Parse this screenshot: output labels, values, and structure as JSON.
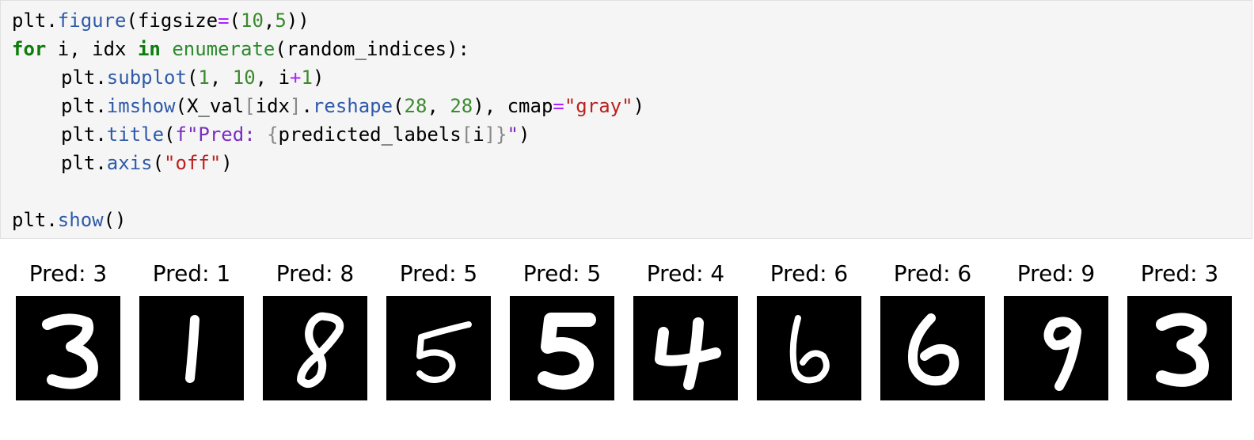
{
  "code_cell": {
    "lines": [
      {
        "indent": false,
        "tokens": [
          {
            "t": "plt.",
            "c": "#000000"
          },
          {
            "t": "figure",
            "c": "#2f5aa8"
          },
          {
            "t": "(figsize",
            "c": "#000000"
          },
          {
            "t": "=",
            "c": "#aa22ff"
          },
          {
            "t": "(",
            "c": "#000000"
          },
          {
            "t": "10",
            "c": "#3c8a2e"
          },
          {
            "t": ",",
            "c": "#000000"
          },
          {
            "t": "5",
            "c": "#3c8a2e"
          },
          {
            "t": "))",
            "c": "#000000"
          }
        ]
      },
      {
        "indent": false,
        "tokens": [
          {
            "t": "for",
            "c": "#0a7d0a",
            "kw": true
          },
          {
            "t": " i, idx ",
            "c": "#000000"
          },
          {
            "t": "in",
            "c": "#0a7d0a",
            "kw": true
          },
          {
            "t": " ",
            "c": "#000000"
          },
          {
            "t": "enumerate",
            "c": "#2e8b2e"
          },
          {
            "t": "(random_indices):",
            "c": "#000000"
          }
        ]
      },
      {
        "indent": true,
        "tokens": [
          {
            "t": "plt.",
            "c": "#000000"
          },
          {
            "t": "subplot",
            "c": "#2f5aa8"
          },
          {
            "t": "(",
            "c": "#000000"
          },
          {
            "t": "1",
            "c": "#3c8a2e"
          },
          {
            "t": ", ",
            "c": "#000000"
          },
          {
            "t": "10",
            "c": "#3c8a2e"
          },
          {
            "t": ", i",
            "c": "#000000"
          },
          {
            "t": "+",
            "c": "#aa22ff"
          },
          {
            "t": "1",
            "c": "#3c8a2e"
          },
          {
            "t": ")",
            "c": "#000000"
          }
        ]
      },
      {
        "indent": true,
        "tokens": [
          {
            "t": "plt.",
            "c": "#000000"
          },
          {
            "t": "imshow",
            "c": "#2f5aa8"
          },
          {
            "t": "(X_val",
            "c": "#000000"
          },
          {
            "t": "[",
            "c": "#888888"
          },
          {
            "t": "idx",
            "c": "#000000"
          },
          {
            "t": "]",
            "c": "#888888"
          },
          {
            "t": ".",
            "c": "#000000"
          },
          {
            "t": "reshape",
            "c": "#2f5aa8"
          },
          {
            "t": "(",
            "c": "#000000"
          },
          {
            "t": "28",
            "c": "#3c8a2e"
          },
          {
            "t": ", ",
            "c": "#000000"
          },
          {
            "t": "28",
            "c": "#3c8a2e"
          },
          {
            "t": "), cmap",
            "c": "#000000"
          },
          {
            "t": "=",
            "c": "#aa22ff"
          },
          {
            "t": "\"gray\"",
            "c": "#ba2121"
          },
          {
            "t": ")",
            "c": "#000000"
          }
        ]
      },
      {
        "indent": true,
        "tokens": [
          {
            "t": "plt.",
            "c": "#000000"
          },
          {
            "t": "title",
            "c": "#2f5aa8"
          },
          {
            "t": "(",
            "c": "#000000"
          },
          {
            "t": "f\"Pred: ",
            "c": "#7a2dbf"
          },
          {
            "t": "{",
            "c": "#888888"
          },
          {
            "t": "predicted_labels",
            "c": "#000000"
          },
          {
            "t": "[",
            "c": "#888888"
          },
          {
            "t": "i",
            "c": "#000000"
          },
          {
            "t": "]}",
            "c": "#888888"
          },
          {
            "t": "\"",
            "c": "#7a2dbf"
          },
          {
            "t": ")",
            "c": "#000000"
          }
        ]
      },
      {
        "indent": true,
        "tokens": [
          {
            "t": "plt.",
            "c": "#000000"
          },
          {
            "t": "axis",
            "c": "#2f5aa8"
          },
          {
            "t": "(",
            "c": "#000000"
          },
          {
            "t": "\"off\"",
            "c": "#ba2121"
          },
          {
            "t": ")",
            "c": "#000000"
          }
        ]
      },
      {
        "indent": false,
        "tokens": []
      },
      {
        "indent": false,
        "tokens": [
          {
            "t": "plt.",
            "c": "#000000"
          },
          {
            "t": "show",
            "c": "#2f5aa8"
          },
          {
            "t": "()",
            "c": "#000000"
          }
        ]
      }
    ]
  },
  "output": {
    "panels": [
      {
        "title": "Pred: 3",
        "digit": "3"
      },
      {
        "title": "Pred: 1",
        "digit": "1"
      },
      {
        "title": "Pred: 8",
        "digit": "8"
      },
      {
        "title": "Pred: 5",
        "digit": "5"
      },
      {
        "title": "Pred: 5",
        "digit": "5"
      },
      {
        "title": "Pred: 4",
        "digit": "4"
      },
      {
        "title": "Pred: 6",
        "digit": "6"
      },
      {
        "title": "Pred: 6",
        "digit": "6"
      },
      {
        "title": "Pred: 9",
        "digit": "9"
      },
      {
        "title": "Pred: 3",
        "digit": "3"
      }
    ]
  }
}
